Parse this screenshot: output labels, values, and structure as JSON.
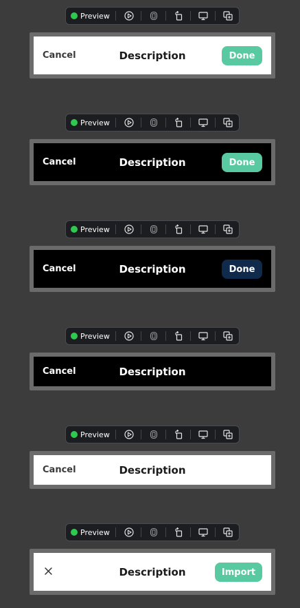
{
  "toolbar": {
    "preview_label": "Preview",
    "status_color": "#2fc94f",
    "icons": [
      "play-circle-icon",
      "device-icon",
      "rotate-icon",
      "desktop-icon",
      "duplicate-icon"
    ]
  },
  "colors": {
    "green_button": "#58c9a0",
    "navy_button": "#0f2a4a",
    "canvas": "#3c3c3c",
    "frame": "#6b6b6b"
  },
  "variants": [
    {
      "theme": "light",
      "cancel_label": "Cancel",
      "title": "Description",
      "action_label": "Done",
      "action_style": "green"
    },
    {
      "theme": "dark",
      "cancel_label": "Cancel",
      "title": "Description",
      "action_label": "Done",
      "action_style": "green"
    },
    {
      "theme": "dark",
      "cancel_label": "Cancel",
      "title": "Description",
      "action_label": "Done",
      "action_style": "navy"
    },
    {
      "theme": "dark",
      "cancel_label": "Cancel",
      "title": "Description",
      "action_label": null
    },
    {
      "theme": "light",
      "cancel_label": "Cancel",
      "title": "Description",
      "action_label": null
    },
    {
      "theme": "light",
      "leading_icon": "close-icon",
      "title": "Description",
      "action_label": "Import",
      "action_style": "green"
    }
  ]
}
